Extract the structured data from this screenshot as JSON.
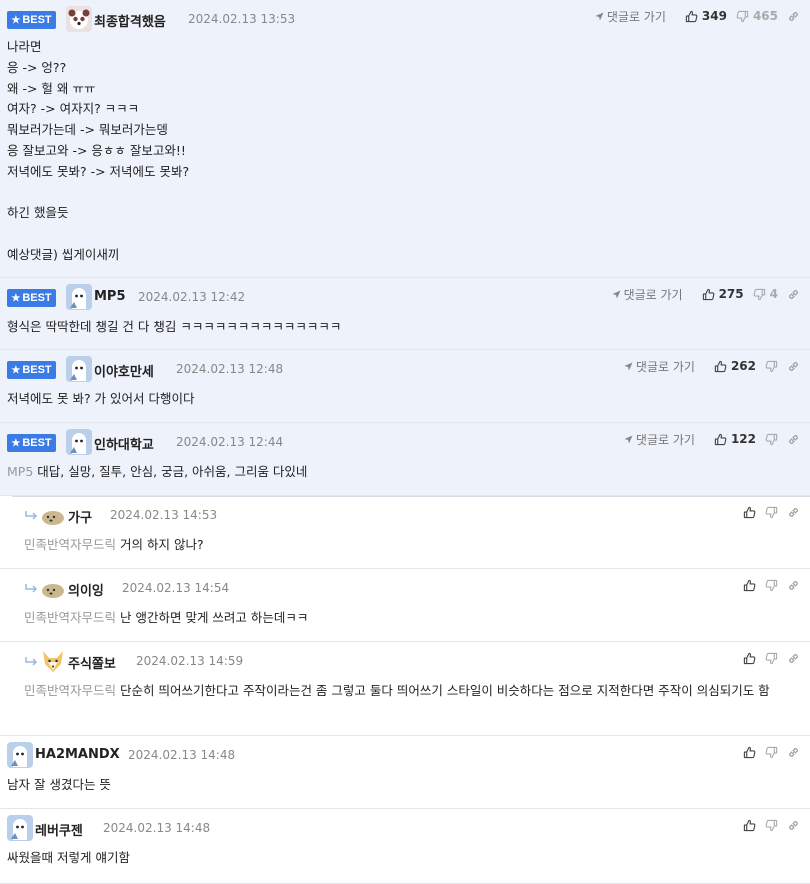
{
  "ui": {
    "best_label": "BEST",
    "goto_label": "댓글로 가기"
  },
  "comments": [
    {
      "nick": "최종합격했음",
      "date": "2024.02.13 13:53",
      "likes": "349",
      "dislikes": "465",
      "body": "나라면\n응 -> 엉??\n왜 -> 헐 왜 ㅠㅠ\n여자? -> 여자지? ㅋㅋㅋ\n뭐보러가는데 -> 뭐보러가는뎅\n응 잘보고와 -> 응ㅎㅎ 잘보고와!!\n저녁에도 못봐? -> 저녁에도 못봐?\n\n하긴 했을듯\n\n예상댓글) 씹게이새끼"
    },
    {
      "nick": "MP5",
      "date": "2024.02.13 12:42",
      "likes": "275",
      "dislikes": "4",
      "body": "형식은 딱딱한데 챙길 건 다 챙김 ㅋㅋㅋㅋㅋㅋㅋㅋㅋㅋㅋㅋㅋㅋ"
    },
    {
      "nick": "이야호만세",
      "date": "2024.02.13 12:48",
      "likes": "262",
      "body": "저녁에도 못 봐? 가 있어서 다행이다"
    },
    {
      "nick": "인하대학교",
      "date": "2024.02.13 12:44",
      "likes": "122",
      "mention": "MP5",
      "body": "대답, 실망, 질투, 안심, 궁금, 아쉬움, 그리움 다있네"
    },
    {
      "nick": "가구",
      "date": "2024.02.13 14:53",
      "mention": "민족반역자무드릭",
      "body": "거의 하지 않나?"
    },
    {
      "nick": "의이잉",
      "date": "2024.02.13 14:54",
      "mention": "민족반역자무드릭",
      "body": "난 앵간하면 맞게 쓰려고 하는데ㅋㅋ"
    },
    {
      "nick": "주식쫄보",
      "date": "2024.02.13 14:59",
      "mention": "민족반역자무드릭",
      "body": "단순히 띄어쓰기한다고 주작이라는건 좀 그렇고 둘다 띄어쓰기 스타일이 비슷하다는 점으로 지적한다면 주작이 의심되기도 함"
    },
    {
      "nick": "HA2MANDX",
      "date": "2024.02.13 14:48",
      "body": "남자 잘 생겼다는 뜻"
    },
    {
      "nick": "레버쿠젠",
      "date": "2024.02.13 14:48",
      "body": "싸웠을때 저렇게 얘기함"
    }
  ],
  "colors": {
    "best_bg": "#eef2fb",
    "badge": "#3a7be6",
    "mention": "#999999"
  },
  "icons": [
    "star-icon",
    "thumb-up-icon",
    "thumb-down-icon",
    "link-icon",
    "arrow-icon",
    "reply-arrow-icon",
    "avatar-icon"
  ]
}
